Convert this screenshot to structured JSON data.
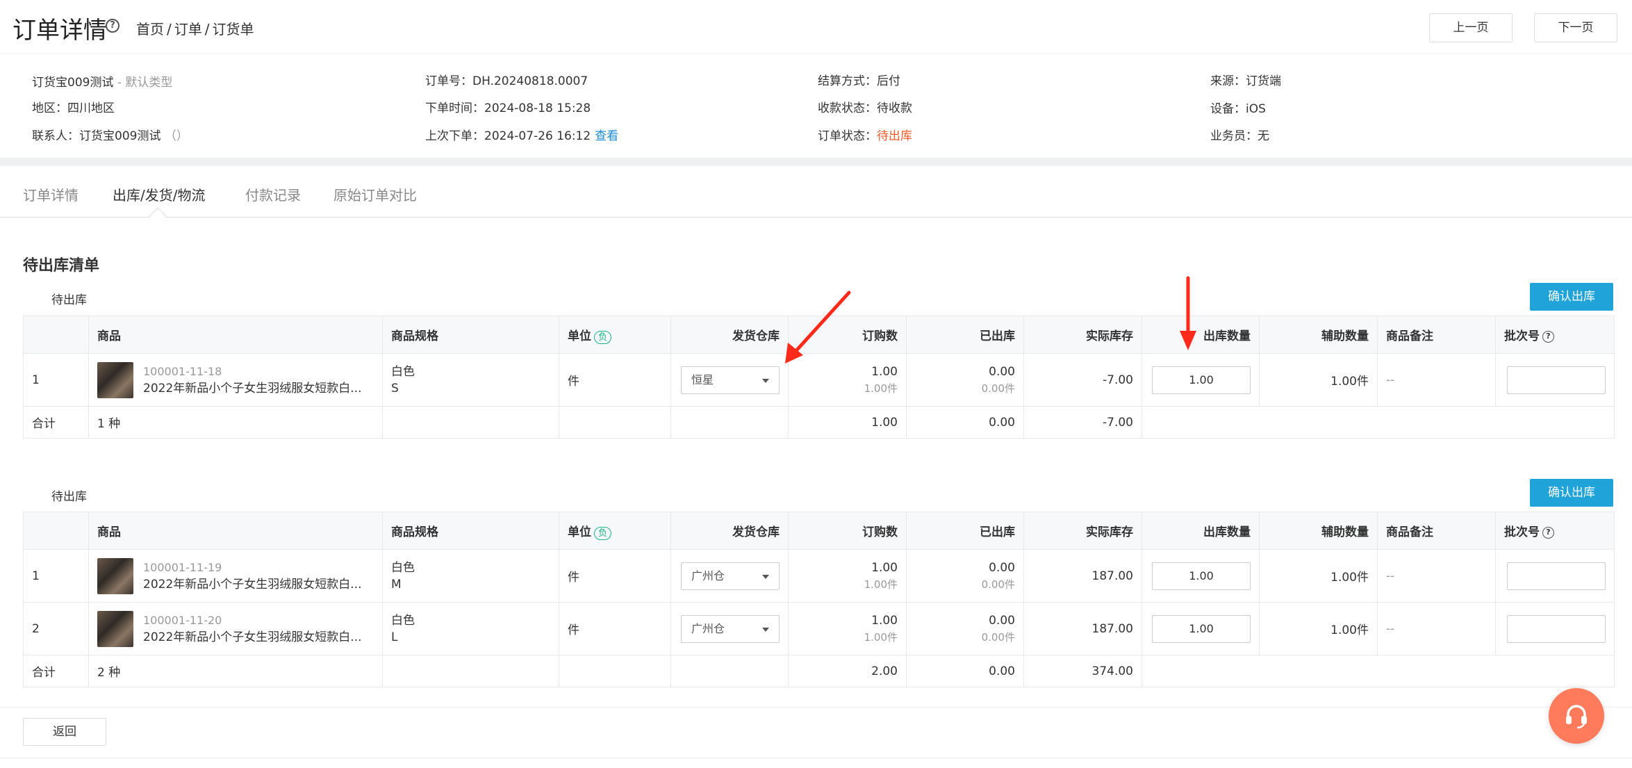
{
  "header": {
    "title": "订单详情",
    "breadcrumb": [
      "首页",
      "/",
      "订单",
      "/",
      "订货单"
    ],
    "prev_label": "上一页",
    "next_label": "下一页"
  },
  "info": {
    "customer": "订货宝009测试",
    "customer_type": "- 默认类型",
    "region_label": "地区：",
    "region": "四川地区",
    "contact_label": "联系人：",
    "contact": "订货宝009测试",
    "contact_phone": "（）",
    "order_no_label": "订单号：",
    "order_no": "DH.20240818.0007",
    "order_time_label": "下单时间：",
    "order_time": "2024-08-18 15:28",
    "last_order_label": "上次下单：",
    "last_order": "2024-07-26 16:12",
    "view_link": "查看",
    "settle_label": "结算方式：",
    "settle": "后付",
    "pay_status_label": "收款状态：",
    "pay_status": "待收款",
    "order_status_label": "订单状态：",
    "order_status": "待出库",
    "source_label": "来源：",
    "source": "订货端",
    "device_label": "设备：",
    "device": "iOS",
    "sales_label": "业务员：",
    "sales": "无"
  },
  "tabs": [
    "订单详情",
    "出库/发货/物流",
    "付款记录",
    "原始订单对比"
  ],
  "section_title": "待出库清单",
  "columns": {
    "product": "商品",
    "spec": "商品规格",
    "unit": "单位",
    "unit_badge": "负",
    "warehouse": "发货仓库",
    "ordered": "订购数",
    "shipped": "已出库",
    "stock": "实际库存",
    "out_qty": "出库数量",
    "aux_qty": "辅助数量",
    "remark": "商品备注",
    "batch": "批次号"
  },
  "group1": {
    "label": "待出库",
    "confirm": "确认出库",
    "rows": [
      {
        "idx": "1",
        "code": "100001-11-18",
        "name": "2022年新品小个子女生羽绒服女短款白...",
        "color": "白色",
        "size": "S",
        "unit": "件",
        "warehouse": "恒星",
        "ordered": "1.00",
        "ordered_sub": "1.00件",
        "shipped": "0.00",
        "shipped_sub": "0.00件",
        "stock": "-7.00",
        "out_qty": "1.00",
        "aux": "1.00件",
        "remark": "--"
      }
    ],
    "sum": {
      "label": "合计",
      "kinds": "1 种",
      "ordered": "1.00",
      "shipped": "0.00",
      "stock": "-7.00"
    }
  },
  "group2": {
    "label": "待出库",
    "confirm": "确认出库",
    "rows": [
      {
        "idx": "1",
        "code": "100001-11-19",
        "name": "2022年新品小个子女生羽绒服女短款白...",
        "color": "白色",
        "size": "M",
        "unit": "件",
        "warehouse": "广州仓",
        "ordered": "1.00",
        "ordered_sub": "1.00件",
        "shipped": "0.00",
        "shipped_sub": "0.00件",
        "stock": "187.00",
        "out_qty": "1.00",
        "aux": "1.00件",
        "remark": "--"
      },
      {
        "idx": "2",
        "code": "100001-11-20",
        "name": "2022年新品小个子女生羽绒服女短款白...",
        "color": "白色",
        "size": "L",
        "unit": "件",
        "warehouse": "广州仓",
        "ordered": "1.00",
        "ordered_sub": "1.00件",
        "shipped": "0.00",
        "shipped_sub": "0.00件",
        "stock": "187.00",
        "out_qty": "1.00",
        "aux": "1.00件",
        "remark": "--"
      }
    ],
    "sum": {
      "label": "合计",
      "kinds": "2 种",
      "ordered": "2.00",
      "shipped": "0.00",
      "stock": "374.00"
    }
  },
  "back_label": "返回",
  "colors": {
    "accent": "#1fa3d9",
    "status_orange": "#f05a28",
    "link": "#1a8ad4",
    "arrow": "#ff2a1a",
    "support": "#ff7b5c"
  }
}
